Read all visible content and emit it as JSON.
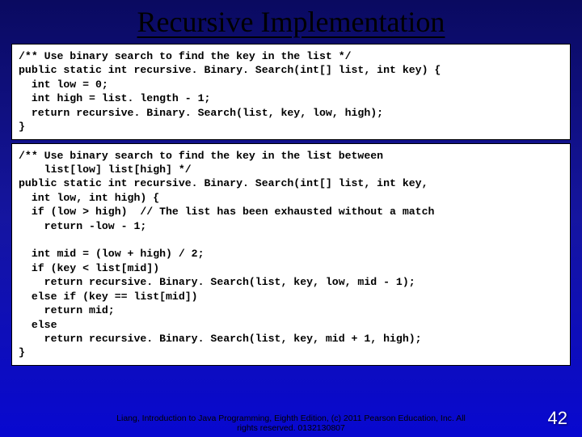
{
  "title": "Recursive Implementation",
  "code_block_1": "/** Use binary search to find the key in the list */\npublic static int recursive. Binary. Search(int[] list, int key) {\n  int low = 0;\n  int high = list. length - 1;\n  return recursive. Binary. Search(list, key, low, high);\n}",
  "code_block_2": "/** Use binary search to find the key in the list between\n    list[low] list[high] */\npublic static int recursive. Binary. Search(int[] list, int key,\n  int low, int high) {\n  if (low > high)  // The list has been exhausted without a match\n    return -low - 1;\n\n  int mid = (low + high) / 2;\n  if (key < list[mid])\n    return recursive. Binary. Search(list, key, low, mid - 1);\n  else if (key == list[mid])\n    return mid;\n  else\n    return recursive. Binary. Search(list, key, mid + 1, high);\n}",
  "footer_line1": "Liang, Introduction to Java Programming, Eighth Edition, (c) 2011 Pearson Education, Inc. All",
  "footer_line2": "rights reserved. 0132130807",
  "page_number": "42"
}
